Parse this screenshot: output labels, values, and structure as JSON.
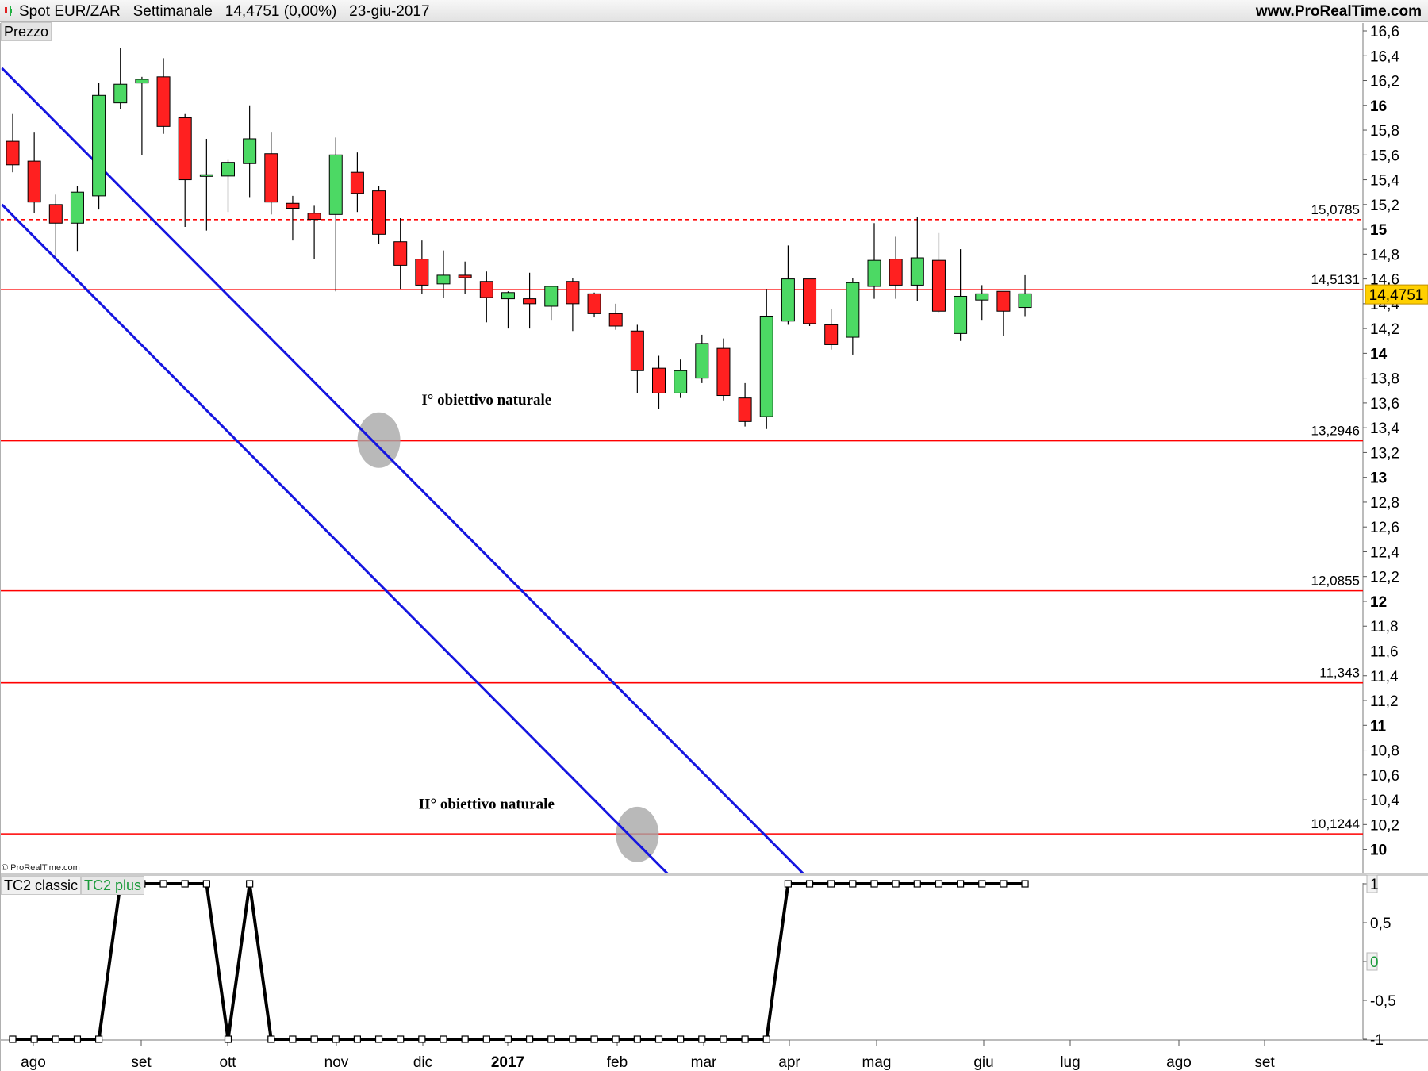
{
  "header": {
    "instrument": "Spot EUR/ZAR",
    "timeframe": "Settimanale",
    "price": "14,4751 (0,00%)",
    "date": "23-giu-2017",
    "site": "www.ProRealTime.com"
  },
  "price_panel_label": "Prezzo",
  "indicator_tabs": [
    "TC2 classic",
    "TC2 plus"
  ],
  "copyright": "© ProRealTime.com",
  "colors": {
    "up": "#4cd964",
    "down": "#ff2020",
    "channel": "#1515e0",
    "level": "#ff0000",
    "tc2": "#000000",
    "current_badge": "#ffd000"
  },
  "chart_data": [
    {
      "type": "candlestick",
      "x_labels": [
        "ago",
        "set",
        "ott",
        "nov",
        "dic",
        "2017",
        "feb",
        "mar",
        "apr",
        "mag",
        "giu",
        "lug",
        "ago",
        "set"
      ],
      "ylim": [
        9.7,
        16.7
      ],
      "y_ticks": [
        "16,6",
        "16,4",
        "16,2",
        "16",
        "15,8",
        "15,6",
        "15,4",
        "15,2",
        "15",
        "14,8",
        "14,6",
        "14,4",
        "14,2",
        "14",
        "13,8",
        "13,6",
        "13,4",
        "13,2",
        "13",
        "12,8",
        "12,6",
        "12,4",
        "12,2",
        "12",
        "11,8",
        "11,6",
        "11,4",
        "11,2",
        "11",
        "10,8",
        "10,6",
        "10,4",
        "10,2",
        "10"
      ],
      "current_price": "14,4751",
      "candles": [
        {
          "o": 15.71,
          "h": 15.93,
          "l": 15.46,
          "c": 15.52
        },
        {
          "o": 15.55,
          "h": 15.78,
          "l": 15.13,
          "c": 15.22
        },
        {
          "o": 15.2,
          "h": 15.28,
          "l": 14.78,
          "c": 15.05
        },
        {
          "o": 15.05,
          "h": 15.35,
          "l": 14.82,
          "c": 15.3
        },
        {
          "o": 15.27,
          "h": 16.18,
          "l": 15.16,
          "c": 16.08
        },
        {
          "o": 16.02,
          "h": 16.46,
          "l": 15.97,
          "c": 16.17
        },
        {
          "o": 16.18,
          "h": 16.23,
          "l": 15.6,
          "c": 16.21
        },
        {
          "o": 16.23,
          "h": 16.38,
          "l": 15.77,
          "c": 15.83
        },
        {
          "o": 15.9,
          "h": 15.93,
          "l": 15.02,
          "c": 15.4
        },
        {
          "o": 15.43,
          "h": 15.73,
          "l": 14.99,
          "c": 15.44
        },
        {
          "o": 15.43,
          "h": 15.56,
          "l": 15.14,
          "c": 15.54
        },
        {
          "o": 15.53,
          "h": 16.0,
          "l": 15.26,
          "c": 15.73
        },
        {
          "o": 15.61,
          "h": 15.78,
          "l": 15.12,
          "c": 15.22
        },
        {
          "o": 15.21,
          "h": 15.27,
          "l": 14.91,
          "c": 15.17
        },
        {
          "o": 15.13,
          "h": 15.19,
          "l": 14.76,
          "c": 15.08
        },
        {
          "o": 15.12,
          "h": 15.74,
          "l": 14.5,
          "c": 15.6
        },
        {
          "o": 15.46,
          "h": 15.62,
          "l": 15.14,
          "c": 15.29
        },
        {
          "o": 15.31,
          "h": 15.35,
          "l": 14.88,
          "c": 14.96
        },
        {
          "o": 14.9,
          "h": 15.09,
          "l": 14.52,
          "c": 14.71
        },
        {
          "o": 14.76,
          "h": 14.91,
          "l": 14.48,
          "c": 14.55
        },
        {
          "o": 14.56,
          "h": 14.83,
          "l": 14.45,
          "c": 14.63
        },
        {
          "o": 14.63,
          "h": 14.74,
          "l": 14.48,
          "c": 14.61
        },
        {
          "o": 14.58,
          "h": 14.66,
          "l": 14.25,
          "c": 14.45
        },
        {
          "o": 14.44,
          "h": 14.5,
          "l": 14.2,
          "c": 14.49
        },
        {
          "o": 14.44,
          "h": 14.65,
          "l": 14.2,
          "c": 14.4
        },
        {
          "o": 14.38,
          "h": 14.52,
          "l": 14.27,
          "c": 14.54
        },
        {
          "o": 14.58,
          "h": 14.61,
          "l": 14.18,
          "c": 14.4
        },
        {
          "o": 14.48,
          "h": 14.49,
          "l": 14.29,
          "c": 14.32
        },
        {
          "o": 14.32,
          "h": 14.4,
          "l": 14.19,
          "c": 14.22
        },
        {
          "o": 14.18,
          "h": 14.23,
          "l": 13.68,
          "c": 13.86
        },
        {
          "o": 13.88,
          "h": 13.98,
          "l": 13.55,
          "c": 13.68
        },
        {
          "o": 13.68,
          "h": 13.95,
          "l": 13.64,
          "c": 13.86
        },
        {
          "o": 13.8,
          "h": 14.15,
          "l": 13.76,
          "c": 14.08
        },
        {
          "o": 14.04,
          "h": 14.12,
          "l": 13.62,
          "c": 13.66
        },
        {
          "o": 13.64,
          "h": 13.76,
          "l": 13.41,
          "c": 13.45
        },
        {
          "o": 13.49,
          "h": 14.52,
          "l": 13.39,
          "c": 14.3
        },
        {
          "o": 14.26,
          "h": 14.87,
          "l": 14.23,
          "c": 14.6
        },
        {
          "o": 14.6,
          "h": 14.6,
          "l": 14.22,
          "c": 14.24
        },
        {
          "o": 14.23,
          "h": 14.36,
          "l": 14.03,
          "c": 14.07
        },
        {
          "o": 14.13,
          "h": 14.61,
          "l": 13.99,
          "c": 14.57
        },
        {
          "o": 14.54,
          "h": 15.05,
          "l": 14.44,
          "c": 14.75
        },
        {
          "o": 14.76,
          "h": 14.94,
          "l": 14.44,
          "c": 14.55
        },
        {
          "o": 14.55,
          "h": 15.1,
          "l": 14.42,
          "c": 14.77
        },
        {
          "o": 14.75,
          "h": 14.97,
          "l": 14.33,
          "c": 14.34
        },
        {
          "o": 14.16,
          "h": 14.84,
          "l": 14.1,
          "c": 14.46
        },
        {
          "o": 14.43,
          "h": 14.55,
          "l": 14.27,
          "c": 14.48
        },
        {
          "o": 14.5,
          "h": 14.5,
          "l": 14.14,
          "c": 14.34
        },
        {
          "o": 14.37,
          "h": 14.63,
          "l": 14.3,
          "c": 14.48
        }
      ],
      "levels": [
        {
          "value": 15.0785,
          "label": "15,0785",
          "style": "dashed"
        },
        {
          "value": 14.5131,
          "label": "14,5131",
          "style": "solid"
        },
        {
          "value": 13.2946,
          "label": "13,2946",
          "style": "solid"
        },
        {
          "value": 12.0855,
          "label": "12,0855",
          "style": "solid"
        },
        {
          "value": 11.343,
          "label": "11,343",
          "style": "solid"
        },
        {
          "value": 10.1244,
          "label": "10,1244",
          "style": "solid"
        }
      ],
      "channel_lines": [
        {
          "from": {
            "bar": -0.5,
            "y": 16.3
          },
          "to": {
            "bar": 37.3,
            "y": 9.7
          }
        },
        {
          "from": {
            "bar": -0.5,
            "y": 15.2
          },
          "to": {
            "bar": 31.0,
            "y": 9.7
          }
        }
      ],
      "annotations": [
        {
          "text": "I° obiettivo naturale",
          "bar": 22.0,
          "y": 13.63
        },
        {
          "text": "II° obiettivo naturale",
          "bar": 22.0,
          "y": 10.37
        }
      ],
      "targets": [
        {
          "bar": 17.0,
          "y": 13.3
        },
        {
          "bar": 29.0,
          "y": 10.12
        }
      ]
    },
    {
      "type": "line",
      "y_ticks": [
        "1",
        "0,5",
        "0",
        "-0,5",
        "-1"
      ],
      "ylim": [
        -1.0,
        1.0
      ],
      "values": [
        -1,
        -1,
        -1,
        -1,
        -1,
        1,
        1,
        1,
        1,
        1,
        -1,
        1,
        -1,
        -1,
        -1,
        -1,
        -1,
        -1,
        -1,
        -1,
        -1,
        -1,
        -1,
        -1,
        -1,
        -1,
        -1,
        -1,
        -1,
        -1,
        -1,
        -1,
        -1,
        -1,
        -1,
        -1,
        1,
        1,
        1,
        1,
        1,
        1,
        1,
        1,
        1,
        1,
        1,
        1
      ]
    }
  ]
}
